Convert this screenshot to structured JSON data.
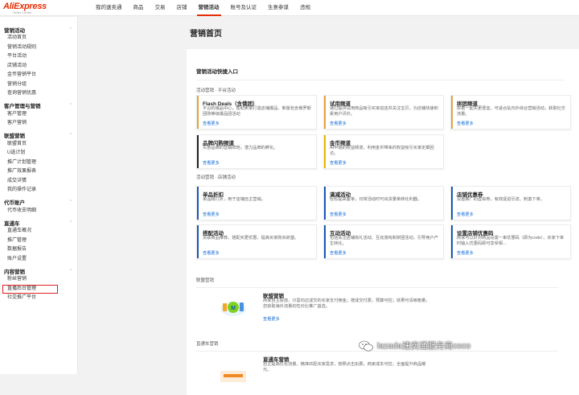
{
  "logo": {
    "brand": "AliExpress",
    "sub": "Seller Center"
  },
  "topnav": [
    {
      "label": "我的速卖通",
      "active": false
    },
    {
      "label": "商品",
      "active": false
    },
    {
      "label": "交易",
      "active": false
    },
    {
      "label": "店铺",
      "active": false
    },
    {
      "label": "营销活动",
      "active": true
    },
    {
      "label": "账号及认证",
      "active": false
    },
    {
      "label": "生意参谋",
      "active": false
    },
    {
      "label": "违规",
      "active": false
    }
  ],
  "sidebar": [
    {
      "title": "营销活动",
      "items": [
        "活动首页",
        "营销活动规则",
        "平台活动",
        "店铺活动",
        "金币营销平台",
        "营销分组",
        "查询营销优惠"
      ]
    },
    {
      "title": "客户管理与营销",
      "items": [
        "客户管理",
        "客户营销"
      ]
    },
    {
      "title": "联盟营销",
      "items": [
        "联盟首页",
        "U选计划",
        "推广计划管理",
        "推广效果报表",
        "成交详情",
        "我的操作记录"
      ]
    },
    {
      "title": "代币账户",
      "items": [
        "代币收支明细"
      ]
    },
    {
      "title": "直通车",
      "items": [
        "直通车概况",
        "推广管理",
        "数据报告",
        "账户设置"
      ]
    },
    {
      "title": "内容营销",
      "items": [
        "粉丝营销",
        "直播后台管理",
        "社交推广平台"
      ]
    }
  ],
  "page_title": "营销首页",
  "panel_title": "营销活动快捷入口",
  "group1": {
    "label": "活动营销 · 平台活动",
    "cards": [
      {
        "title": "Flash Deals（含俄团）",
        "desc": "平台的爆品中心，帮助卖家打造店铺爆品、新版包含俄罗斯团购等级爆品团活动",
        "link": "查看更多",
        "color": "#e6a23c"
      },
      {
        "title": "试用频道",
        "desc": "通过提供试用商品吸引买家进店并关注宝贝，为店铺快速积累用户评价。",
        "link": "查看更多",
        "color": "#e6a23c"
      },
      {
        "title": "拼团频道",
        "desc": "拼着一起买更便宜。可适合站内外综合营销活动，获取社交流量。",
        "link": "查看更多",
        "color": "#e6a23c"
      },
      {
        "title": "品牌闪购频道",
        "desc": "头部品牌的营销阵地，潜力品牌的孵化。",
        "link": "查看更多",
        "color": "#222222"
      },
      {
        "title": "金币频道",
        "desc": "APP端的权益频道，利用金币带来的权益吸引买家定期回访。",
        "link": "查看更多",
        "color": "#e6b800"
      }
    ]
  },
  "group2": {
    "label": "活动营销 · 店铺活动",
    "cards": [
      {
        "title": "单品折扣",
        "desc": "单品级打折，用于店铺自主营销。",
        "link": "查看更多",
        "color": "#1a56b8"
      },
      {
        "title": "满减活动",
        "desc": "轻松提高客单，日常活动时可出货量单转化利器。",
        "link": "查看更多",
        "color": "#1a56b8"
      },
      {
        "title": "店铺优惠券",
        "desc": "设置推广的虚拟券，有效促进引流、刺激下单。",
        "link": "查看更多",
        "color": "#1a56b8"
      },
      {
        "title": "搭配活动",
        "desc": "关联商品推荐，搭配买更优惠，提高买家购买欲望。",
        "link": "查看更多",
        "color": "#1a56b8"
      },
      {
        "title": "互动活动",
        "desc": "包括关注店铺有礼活动、互动游戏和拼团活动，引导用户产生转化。",
        "link": "查看更多",
        "color": "#1a56b8"
      },
      {
        "title": "设置店铺优惠码",
        "desc": "商家可以针对商品设置一串优惠码（即为code），买家下单时输入优惠码即可享受相…",
        "link": "查看更多",
        "color": "#1a56b8"
      }
    ]
  },
  "group3": {
    "label": "联盟营销",
    "title": "联盟营销",
    "desc": "商家自主投放，只需向达成交的买家支付佣金；按成交付费，预算可控；效果可清晰衡量，您获取海外流量的性价比推广首选。",
    "link": "查看更多"
  },
  "group4": {
    "label": "直通车营销",
    "title": "直通车营销",
    "desc": "自主提高优化流量，精准匹配买家需求，按照点击扣费，商家成本可控，全面提升商品曝光。"
  },
  "watermark": "lazada速卖通服务商coco",
  "colors": {
    "brand": "#e62e04",
    "link": "#1a6fd6",
    "highlight": "#e02020"
  }
}
